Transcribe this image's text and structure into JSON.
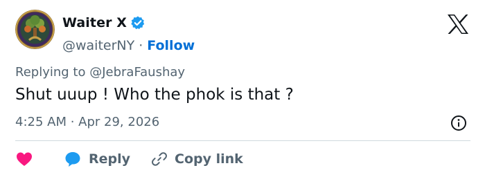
{
  "author": {
    "display_name": "Waiter X",
    "handle": "@waiterNY",
    "separator": "·",
    "follow_label": "Follow",
    "verified": true,
    "avatar_icon": "tree-of-life-avatar"
  },
  "tweet": {
    "replying_to": "Replying to @JebraFaushay",
    "text": "Shut uuup ! Who the phok is that ?",
    "timestamp": "4:25 AM · Apr 29, 2026"
  },
  "actions": {
    "like_icon": "heart-icon",
    "reply_label": "Reply",
    "copy_link_label": "Copy link"
  },
  "colors": {
    "text_primary": "#0f1419",
    "text_secondary": "#536471",
    "link_blue": "#006fd6",
    "verified_blue": "#1d9bf0",
    "like_red": "#f91880",
    "divider": "#cfd9de"
  }
}
